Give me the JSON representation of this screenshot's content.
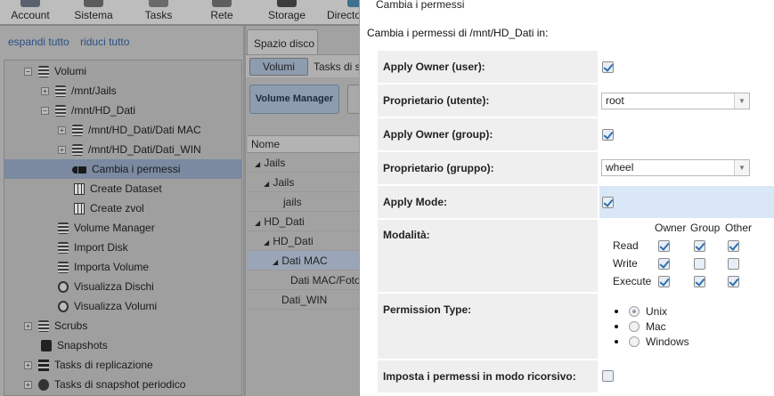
{
  "toolbar": {
    "items": [
      "Account",
      "Sistema",
      "Tasks",
      "Rete",
      "Storage",
      "Directo"
    ]
  },
  "left": {
    "expand_all": "espandi tutto",
    "collapse_all": "riduci tutto",
    "tree": {
      "volumi": "Volumi",
      "jails": "/mnt/Jails",
      "hd_dati": "/mnt/HD_Dati",
      "dati_mac": "/mnt/HD_Dati/Dati MAC",
      "dati_win": "/mnt/HD_Dati/Dati_WIN",
      "cambia_permessi": "Cambia i permessi",
      "create_dataset": "Create Dataset",
      "create_zvol": "Create zvol",
      "volume_manager": "Volume Manager",
      "import_disk": "Import Disk",
      "importa_volume": "Importa Volume",
      "visualizza_dischi": "Visualizza Dischi",
      "visualizza_volumi": "Visualizza Volumi",
      "scrubs": "Scrubs",
      "snapshots": "Snapshots",
      "tasks_replicazione": "Tasks di replicazione",
      "tasks_snapshot": "Tasks di snapshot periodico"
    }
  },
  "middle": {
    "tab": "Spazio disco",
    "subtab_volumi": "Volumi",
    "subtab_tasks": "Tasks di s",
    "volume_manager_button": "Volume Manager",
    "column_name": "Nome",
    "rows": [
      "Jails",
      "Jails",
      "jails",
      "HD_Dati",
      "HD_Dati",
      "Dati MAC",
      "Dati MAC/Foto",
      "Dati_WIN"
    ]
  },
  "dialog": {
    "title": "Cambia i permessi",
    "subtitle": "Cambia i permessi di /mnt/HD_Dati in:",
    "apply_owner_user_label": "Apply Owner (user):",
    "owner_user_label": "Proprietario (utente):",
    "owner_user_value": "root",
    "apply_owner_group_label": "Apply Owner (group):",
    "owner_group_label": "Proprietario (gruppo):",
    "owner_group_value": "wheel",
    "apply_mode_label": "Apply Mode:",
    "mode_label": "Modalità:",
    "perm_cols": [
      "Owner",
      "Group",
      "Other"
    ],
    "perm_rows": [
      "Read",
      "Write",
      "Execute"
    ],
    "permission_type_label": "Permission Type:",
    "permission_types": [
      "Unix",
      "Mac",
      "Windows"
    ],
    "recursive_label": "Imposta i permessi in modo ricorsivo:"
  },
  "state": {
    "apply_owner_user": true,
    "apply_owner_group": true,
    "apply_mode": true,
    "perms": [
      [
        true,
        true,
        true
      ],
      [
        true,
        false,
        false
      ],
      [
        true,
        true,
        true
      ]
    ],
    "permission_type_selected": "Unix",
    "recursive": false
  },
  "colors": {
    "overlay": "#7f7f7f",
    "selected_row": "#7b8aa1",
    "highlight_row": "#d9e7f7",
    "check": "#2e6fb0"
  }
}
